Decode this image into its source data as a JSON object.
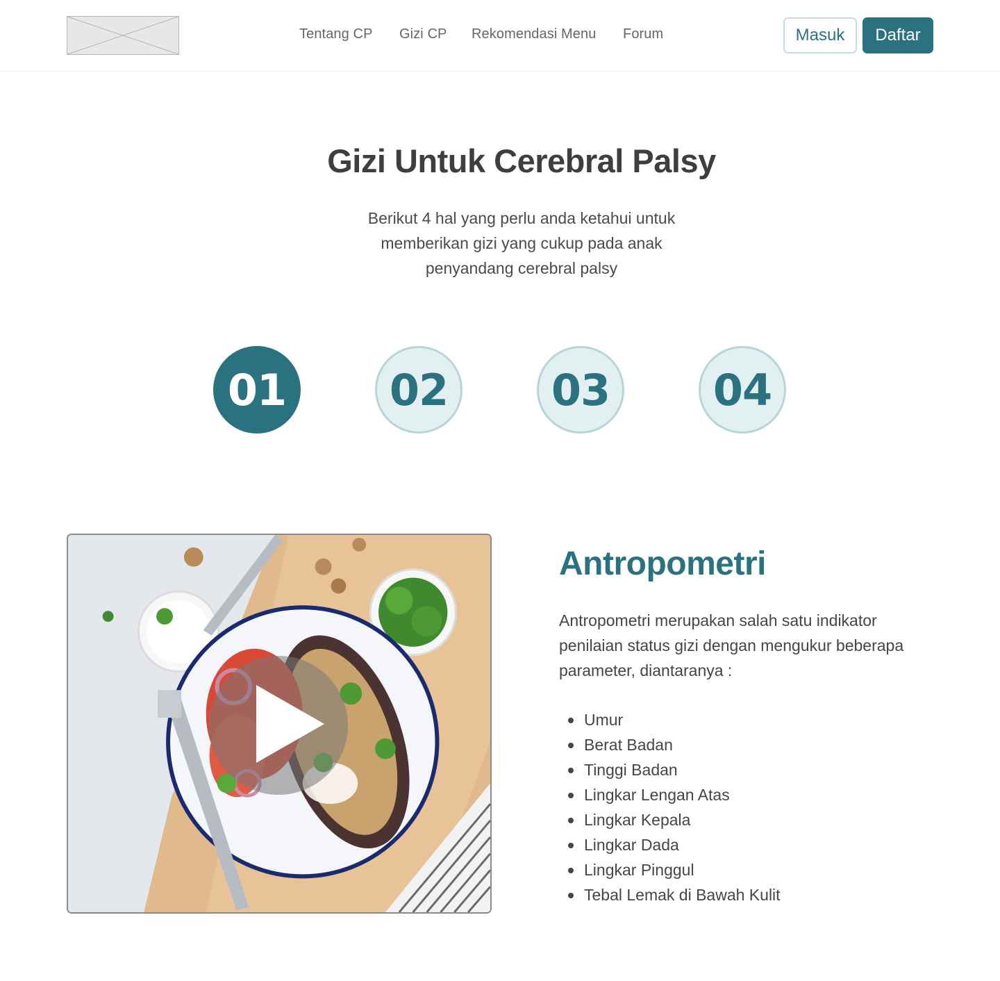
{
  "nav": {
    "items": [
      {
        "label": "Tentang CP"
      },
      {
        "label": "Gizi CP"
      },
      {
        "label": "Rekomendasi Menu"
      },
      {
        "label": "Forum"
      }
    ],
    "login_label": "Masuk",
    "register_label": "Daftar"
  },
  "hero": {
    "title": "Gizi Untuk Cerebral Palsy",
    "subtitle": "Berikut 4 hal yang perlu anda ketahui untuk memberikan gizi yang cukup pada anak penyandang cerebral palsy"
  },
  "steps": [
    {
      "label": "01",
      "active": true
    },
    {
      "label": "02",
      "active": false
    },
    {
      "label": "03",
      "active": false
    },
    {
      "label": "04",
      "active": false
    }
  ],
  "section": {
    "title": "Antropometri",
    "description": "Antropometri merupakan salah satu indikator penilaian status gizi dengan mengukur beberapa parameter, diantaranya :",
    "parameters": [
      "Umur",
      "Berat Badan",
      "Tinggi Badan",
      "Lingkar Lengan Atas",
      "Lingkar Kepala",
      "Lingkar Dada",
      "Lingkar Pinggul",
      "Tebal Lemak di Bawah Kulit"
    ]
  },
  "colors": {
    "brand": "#2a7280",
    "brand_light": "#e3f0f2",
    "text": "#454545"
  },
  "icons": {
    "logo": "logo-placeholder-icon",
    "play": "play-icon"
  }
}
